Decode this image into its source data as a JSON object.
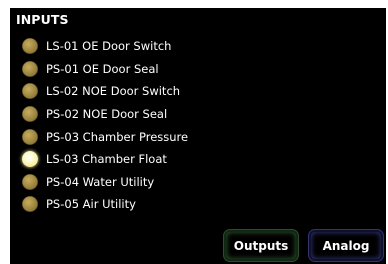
{
  "panel": {
    "title": "INPUTS"
  },
  "inputs": [
    {
      "label": "LS-01 OE Door Switch",
      "state": "off"
    },
    {
      "label": "PS-01 OE Door Seal",
      "state": "off"
    },
    {
      "label": "LS-02 NOE Door Switch",
      "state": "off"
    },
    {
      "label": "PS-02 NOE Door Seal",
      "state": "off"
    },
    {
      "label": "PS-03 Chamber Pressure",
      "state": "off"
    },
    {
      "label": "LS-03 Chamber Float",
      "state": "on"
    },
    {
      "label": "PS-04 Water Utility",
      "state": "off"
    },
    {
      "label": "PS-05 Air Utility",
      "state": "off"
    }
  ],
  "buttons": {
    "outputs_label": "Outputs",
    "analog_label": "Analog"
  },
  "colors": {
    "background": "#000000",
    "text": "#ffffff",
    "led_off": "#9b8340",
    "led_on": "#fffbd0",
    "outputs_button_glow": "#355e35",
    "analog_button_glow": "#3a3d86"
  },
  "icons": {
    "led_off": "status-led-off-icon",
    "led_on": "status-led-on-icon"
  }
}
